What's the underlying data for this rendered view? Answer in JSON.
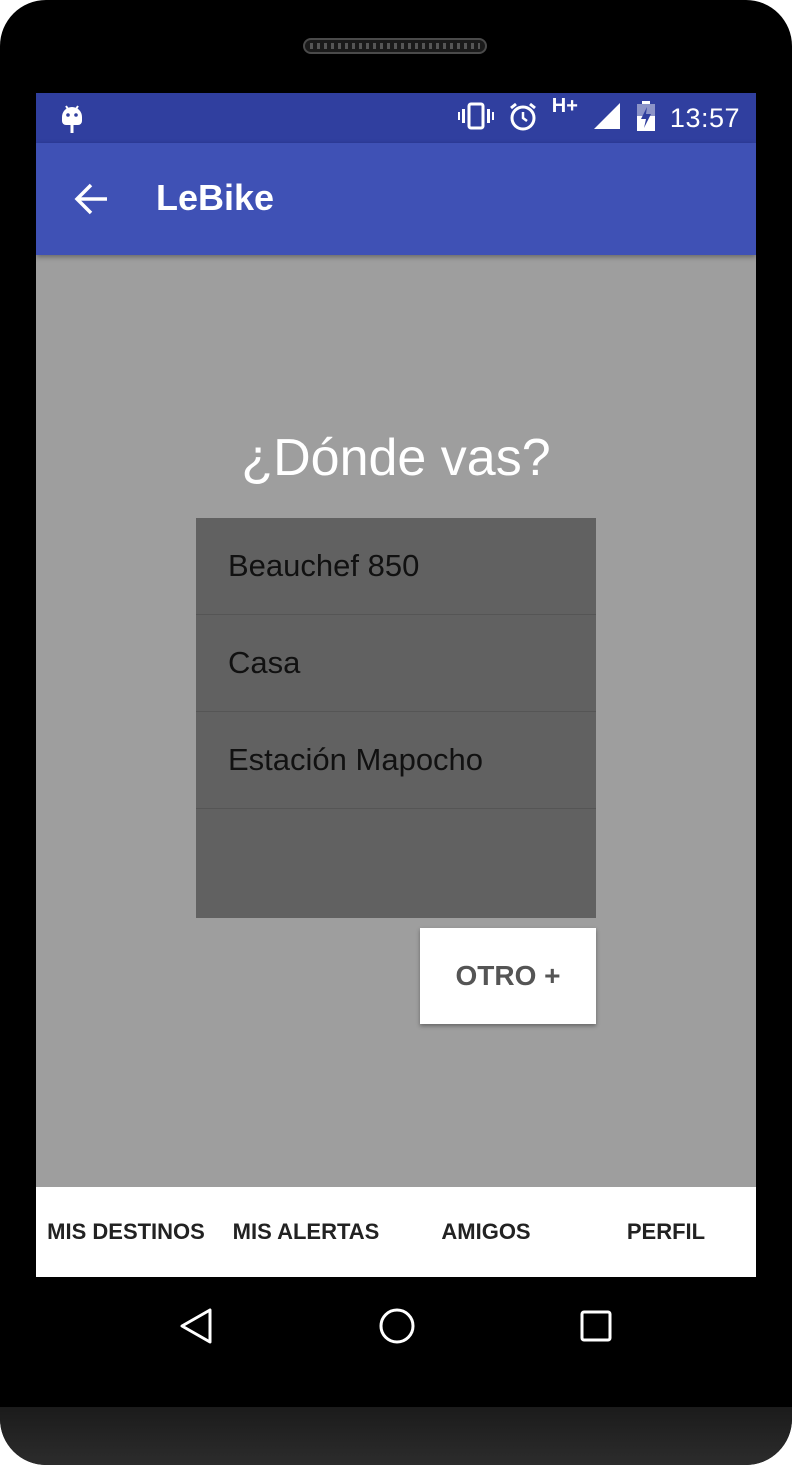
{
  "status_bar": {
    "time": "13:57",
    "network_type": "H+",
    "icons": [
      "android-notification-icon",
      "vibrate-icon",
      "alarm-icon",
      "signal-icon",
      "battery-charging-icon"
    ]
  },
  "app_bar": {
    "title": "LeBike",
    "back_icon": "arrow-back-icon"
  },
  "main": {
    "question": "¿Dónde vas?",
    "destinations": [
      "Beauchef 850",
      "Casa",
      "Estación Mapocho"
    ],
    "other_button_label": "OTRO +"
  },
  "bottom_tabs": [
    "MIS DESTINOS",
    "MIS ALERTAS",
    "AMIGOS",
    "PERFIL"
  ],
  "nav_bar": {
    "icons": [
      "back-triangle-icon",
      "home-circle-icon",
      "recents-square-icon"
    ]
  },
  "colors": {
    "status_bar": "#303f9f",
    "app_bar": "#3f51b5",
    "background": "#9e9e9e",
    "list_background": "#616161"
  }
}
